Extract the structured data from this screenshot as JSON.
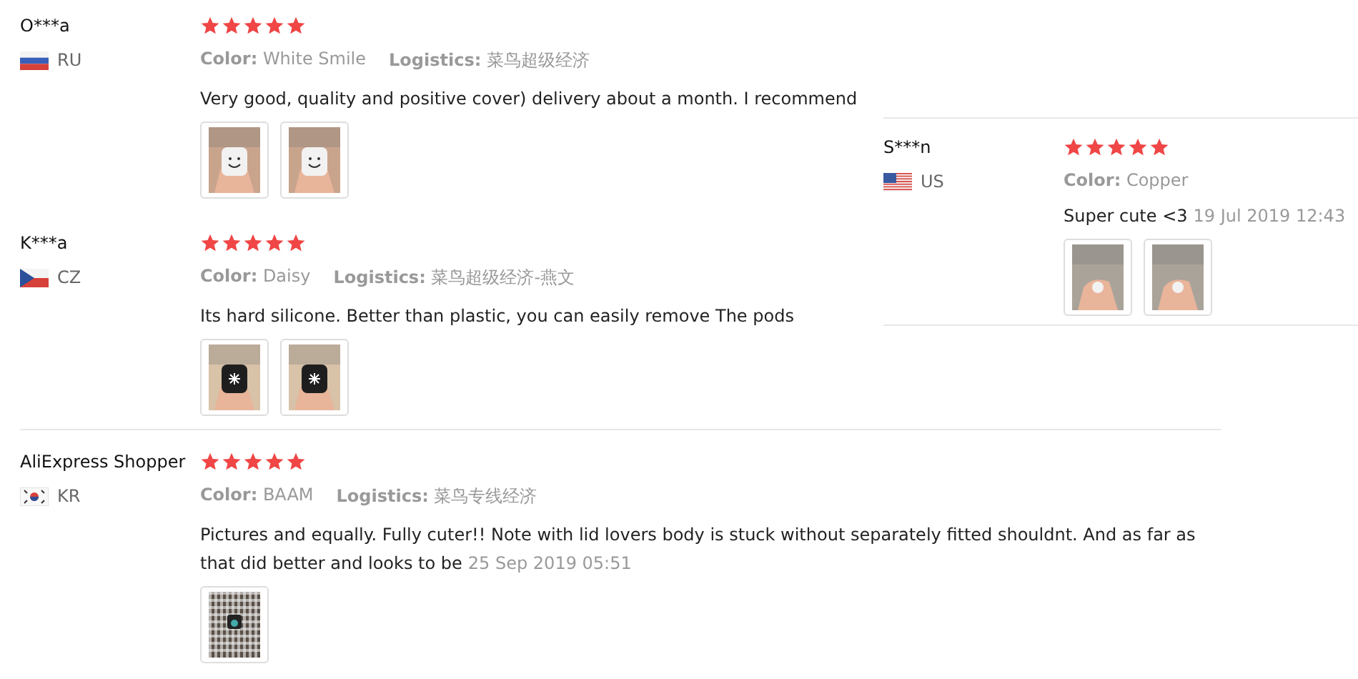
{
  "reviews": [
    {
      "name": "O***a",
      "kind": "ru",
      "country": "RU",
      "stars": 5,
      "color_label": "Color:",
      "color_option": "White Smile",
      "logistics_label": "Logistics:",
      "logistics": "菜鸟超级经济",
      "text": "Very good, quality and positive cover) delivery about a month. I recommend",
      "photos": [
        {
          "kind": "picture"
        },
        {
          "kind": "picture"
        }
      ]
    },
    {
      "name": "S***n",
      "kind": "us",
      "country": "US",
      "stars": 5,
      "color_label": "Color:",
      "color_option": "Copper",
      "text": "Super cute <3",
      "date": "19 Jul 2019 12:43",
      "photos": [
        {
          "kind": "picture"
        },
        {
          "kind": "picture"
        }
      ]
    },
    {
      "name": "K***a",
      "kind": "cz",
      "country": "CZ",
      "stars": 5,
      "color_label": "Color:",
      "color_option": "Daisy",
      "logistics_label": "Logistics:",
      "logistics": "菜鸟超级经济-燕文",
      "text": "Its hard silicone. Better than plastic, you can easily remove The pods",
      "photos": [
        {
          "kind": "picture"
        },
        {
          "kind": "picture"
        }
      ]
    },
    {
      "name": "AliExpress Shopper",
      "kind": "kr",
      "country": "KR",
      "stars": 5,
      "color_label": "Color:",
      "color_option": "BAAM",
      "logistics_label": "Logistics:",
      "logistics": "菜鸟专线经济",
      "text": "Pictures and equally. Fully cuter!! Note with lid lovers body is stuck without separately fitted shouldnt. And as far as that did better and looks to be",
      "date": "25 Sep 2019 05:51",
      "photos": [
        {
          "kind": "picture"
        }
      ]
    }
  ]
}
